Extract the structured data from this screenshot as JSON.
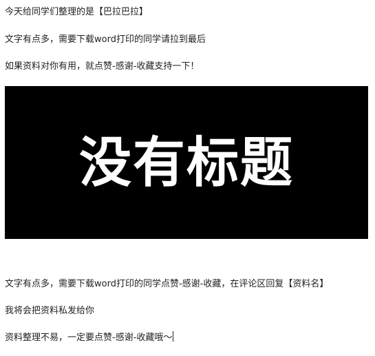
{
  "intro": {
    "line1": "今天给同学们整理的是【巴拉巴拉】",
    "line2": "文字有点多，需要下载word打印的同学请拉到最后",
    "line3": "如果资料对你有用，就点赞-感谢-收藏支持一下！"
  },
  "banner": {
    "title": "没有标题",
    "background": "#000000",
    "text_color": "#ffffff"
  },
  "outro": {
    "line1": "文字有点多，需要下载word打印的同学点赞-感谢-收藏，在评论区回复【资料名】",
    "line2": "我将会把资料私发给你",
    "line3": "资料整理不易，一定要点赞-感谢-收藏哦～"
  }
}
